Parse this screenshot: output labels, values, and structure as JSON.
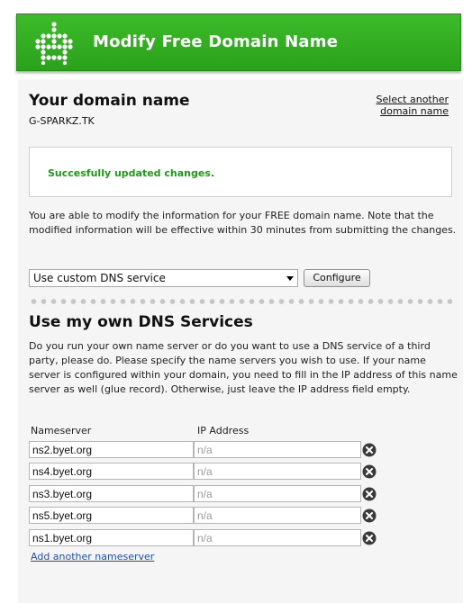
{
  "banner": {
    "title": "Modify Free Domain Name",
    "icon": "robot-icon"
  },
  "domain": {
    "heading": "Your domain name",
    "select_another": "Select another domain name",
    "name": "G-SPARKZ.TK"
  },
  "status": {
    "message": "Succesfully updated changes.",
    "color": "#1e9a1a"
  },
  "info": "You are able to modify the information for your FREE domain name. Note that the modified information will be effective within 30 minutes from submitting the changes.",
  "dns_option": {
    "selected": "Use custom DNS service",
    "configure_label": "Configure"
  },
  "own_dns": {
    "heading": "Use my own DNS Services",
    "description": "Do you run your own name server or do you want to use a DNS service of a third party, please do. Please specify the name servers you wish to use. If your name server is configured within your domain, you need to fill in the IP address of this name server as well (glue record). Otherwise, just leave the IP address field empty.",
    "col_nameserver": "Nameserver",
    "col_ip": "IP Address",
    "ip_placeholder": "n/a",
    "nameservers": [
      {
        "name": "ns2.byet.org",
        "ip": ""
      },
      {
        "name": "ns4.byet.org",
        "ip": ""
      },
      {
        "name": "ns3.byet.org",
        "ip": ""
      },
      {
        "name": "ns5.byet.org",
        "ip": ""
      },
      {
        "name": "ns1.byet.org",
        "ip": ""
      }
    ],
    "add_link": "Add another nameserver"
  },
  "colors": {
    "accent": "#2aa11b",
    "link": "#1f4fb5"
  }
}
